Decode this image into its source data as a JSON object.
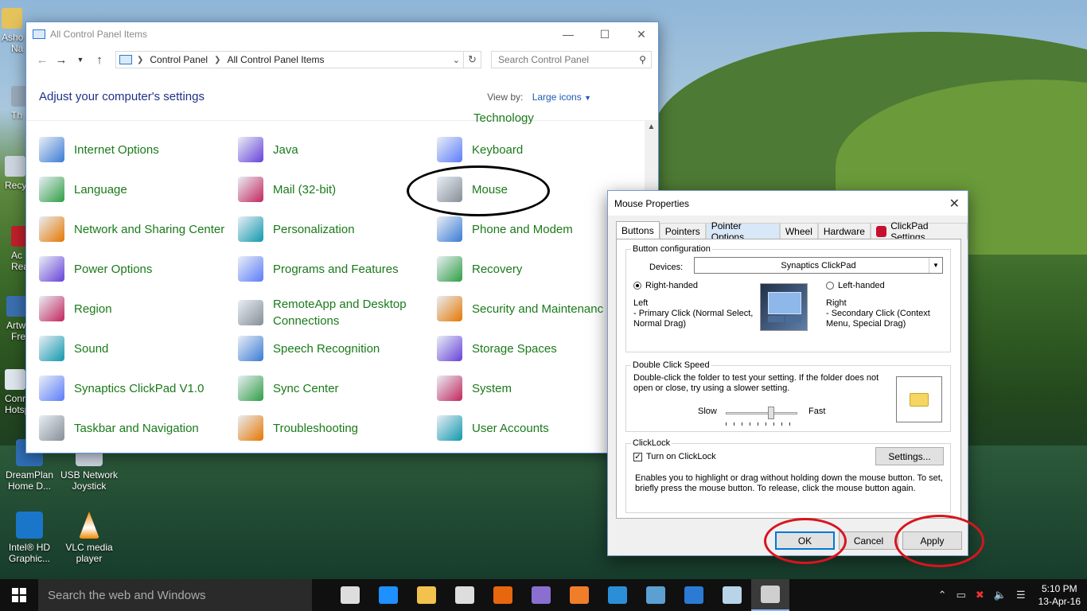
{
  "desktop": {
    "icons": [
      {
        "label_line1": "DreamPlan",
        "label_line2": "Home D...",
        "color": "#2f6fb7"
      },
      {
        "label_line1": "USB Network",
        "label_line2": "Joystick",
        "color": "#cfd8e4"
      },
      {
        "label_line1": "Intel® HD",
        "label_line2": "Graphic...",
        "color": "#1a76c8"
      },
      {
        "label_line1": "VLC media",
        "label_line2": "player",
        "color": "#f08a00"
      }
    ],
    "partial_labels": [
      "Asho",
      "Na",
      "Th",
      "Recy",
      "Ac",
      "Rea",
      "Artw",
      "Fre",
      "Conr",
      "Hotsp"
    ]
  },
  "control_panel": {
    "window_title": "All Control Panel Items",
    "breadcrumb": [
      "Control Panel",
      "All Control Panel Items"
    ],
    "search_placeholder": "Search Control Panel",
    "heading": "Adjust your computer's settings",
    "view_by_label": "View by:",
    "view_by_value": "Large icons",
    "partial_top_item": "Technology",
    "columns": [
      [
        {
          "label": "Internet Options",
          "icon": "globe-icon"
        },
        {
          "label": "Language",
          "icon": "language-icon"
        },
        {
          "label": "Network and Sharing Center",
          "icon": "network-icon"
        },
        {
          "label": "Power Options",
          "icon": "power-icon"
        },
        {
          "label": "Region",
          "icon": "region-icon"
        },
        {
          "label": "Sound",
          "icon": "speaker-icon"
        },
        {
          "label": "Synaptics ClickPad V1.0",
          "icon": "synaptics-icon"
        },
        {
          "label": "Taskbar and Navigation",
          "icon": "taskbar-icon"
        }
      ],
      [
        {
          "label": "Java",
          "icon": "java-icon"
        },
        {
          "label": "Mail (32-bit)",
          "icon": "mail-icon"
        },
        {
          "label": "Personalization",
          "icon": "personalization-icon"
        },
        {
          "label": "Programs and Features",
          "icon": "programs-icon"
        },
        {
          "label": "RemoteApp and Desktop Connections",
          "icon": "remoteapp-icon"
        },
        {
          "label": "Speech Recognition",
          "icon": "microphone-icon"
        },
        {
          "label": "Sync Center",
          "icon": "sync-icon"
        },
        {
          "label": "Troubleshooting",
          "icon": "troubleshoot-icon"
        }
      ],
      [
        {
          "label": "Keyboard",
          "icon": "keyboard-icon"
        },
        {
          "label": "Mouse",
          "icon": "mouse-icon"
        },
        {
          "label": "Phone and Modem",
          "icon": "phone-icon"
        },
        {
          "label": "Recovery",
          "icon": "recovery-icon"
        },
        {
          "label": "Security and Maintenanc",
          "icon": "flag-icon"
        },
        {
          "label": "Storage Spaces",
          "icon": "storage-icon"
        },
        {
          "label": "System",
          "icon": "system-icon"
        },
        {
          "label": "User Accounts",
          "icon": "users-icon"
        }
      ]
    ]
  },
  "mouse_properties": {
    "title": "Mouse Properties",
    "tabs": [
      "Buttons",
      "Pointers",
      "Pointer Options",
      "Wheel",
      "Hardware",
      "ClickPad Settings"
    ],
    "active_tab": "Buttons",
    "button_config": {
      "legend": "Button configuration",
      "devices_label": "Devices:",
      "devices_value": "Synaptics ClickPad",
      "right_handed": "Right-handed",
      "left_handed": "Left-handed",
      "left_title": "Left",
      "left_desc": "- Primary Click (Normal Select, Normal Drag)",
      "right_title": "Right",
      "right_desc": "- Secondary Click (Context Menu, Special Drag)"
    },
    "double_click": {
      "legend": "Double Click Speed",
      "desc": "Double-click the folder to test your setting.  If the folder does not open or close, try using a slower setting.",
      "slow": "Slow",
      "fast": "Fast",
      "speed_fraction": 0.65
    },
    "clicklock": {
      "legend": "ClickLock",
      "checkbox_label": "Turn on ClickLock",
      "checked": true,
      "settings_button": "Settings...",
      "desc": "Enables you to highlight or drag without holding down the mouse button.  To set, briefly press the mouse button.  To release, click the mouse button again."
    },
    "buttons": {
      "ok": "OK",
      "cancel": "Cancel",
      "apply": "Apply"
    }
  },
  "taskbar": {
    "search_placeholder": "Search the web and Windows",
    "apps": [
      "task-view-icon",
      "edge-icon",
      "file-explorer-icon",
      "store-icon",
      "firefox-icon",
      "vs-icon",
      "xampp-icon",
      "ie-icon",
      "photos-icon",
      "control-panel-icon",
      "clickpad-icon",
      "mouse-icon"
    ],
    "time": "5:10 PM",
    "date": "13-Apr-16"
  },
  "annotation_colors": {
    "black": "#000000",
    "red": "#d9141e"
  }
}
